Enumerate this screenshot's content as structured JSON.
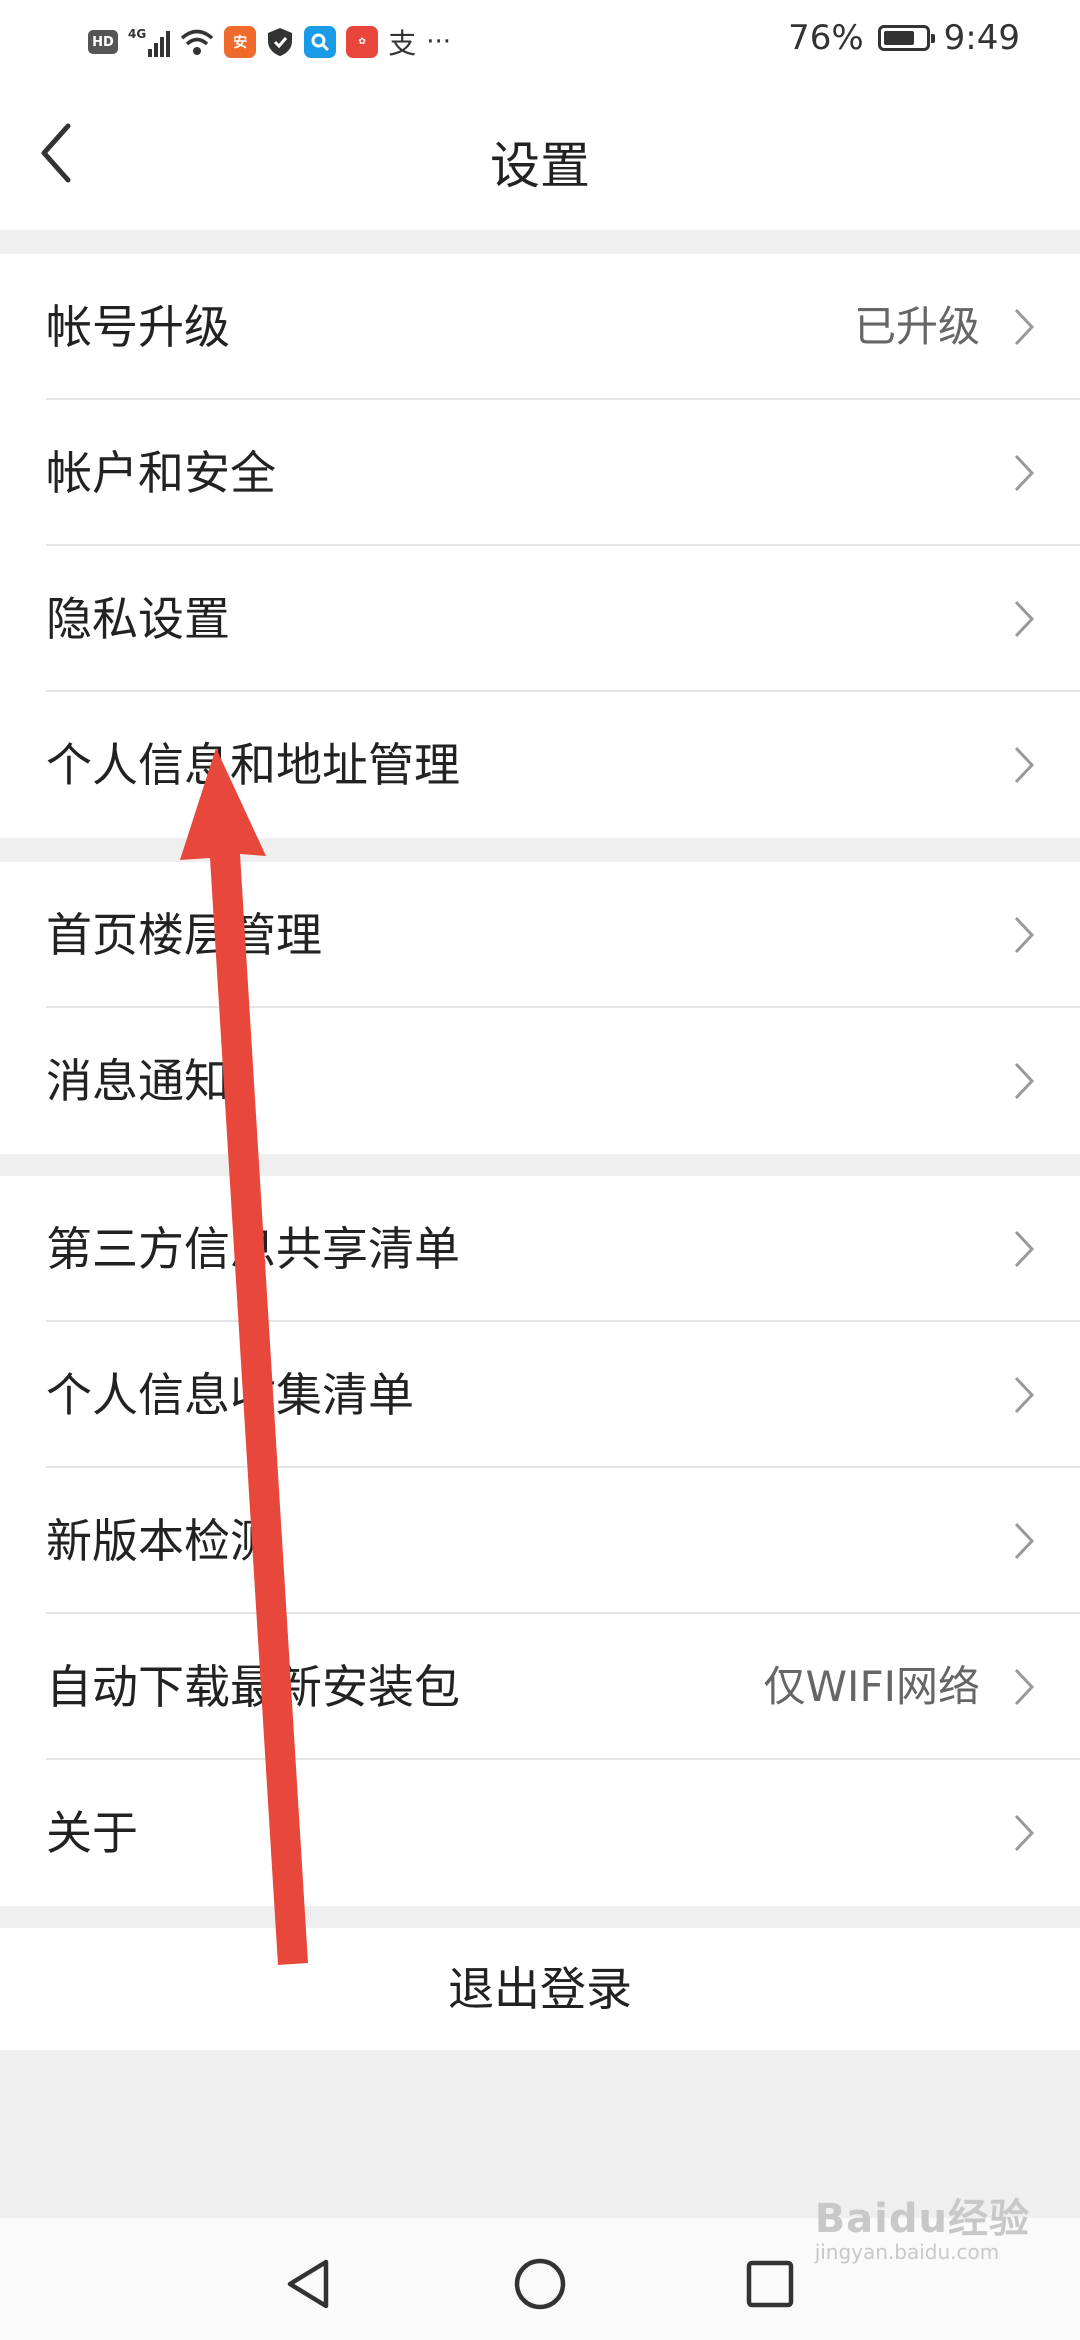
{
  "status_bar": {
    "left_icons": [
      "hd-badge",
      "4g-signal-icon",
      "wifi-icon",
      "pingan-app-icon",
      "shield-icon",
      "search-app-icon",
      "huawei-app-icon",
      "alipay-icon",
      "more-dots-icon"
    ],
    "hd_label": "HD",
    "network_label": "4G",
    "battery_percent": "76%",
    "battery_level": 0.76,
    "time": "9:49"
  },
  "header": {
    "title": "设置",
    "back_icon": "chevron-left-icon"
  },
  "sections": [
    {
      "items": [
        {
          "label": "帐号升级",
          "value": "已升级"
        },
        {
          "label": "帐户和安全",
          "value": ""
        },
        {
          "label": "隐私设置",
          "value": ""
        },
        {
          "label": "个人信息和地址管理",
          "value": ""
        }
      ]
    },
    {
      "items": [
        {
          "label": "首页楼层管理",
          "value": ""
        },
        {
          "label": "消息通知",
          "value": ""
        }
      ]
    },
    {
      "items": [
        {
          "label": "第三方信息共享清单",
          "value": ""
        },
        {
          "label": "个人信息收集清单",
          "value": ""
        },
        {
          "label": "新版本检测",
          "value": ""
        },
        {
          "label": "自动下载最新安装包",
          "value": "仅WIFI网络"
        },
        {
          "label": "关于",
          "value": ""
        }
      ]
    }
  ],
  "logout_label": "退出登录",
  "nav_bar": {
    "icons": [
      "back-triangle-icon",
      "home-circle-icon",
      "recents-square-icon"
    ]
  },
  "watermark": {
    "brand": "Baidu经验",
    "url": "jingyan.baidu.com"
  },
  "colors": {
    "annotation_arrow": "#e8473b",
    "background": "#efefef",
    "row_background": "#ffffff",
    "value_text": "#666666"
  }
}
